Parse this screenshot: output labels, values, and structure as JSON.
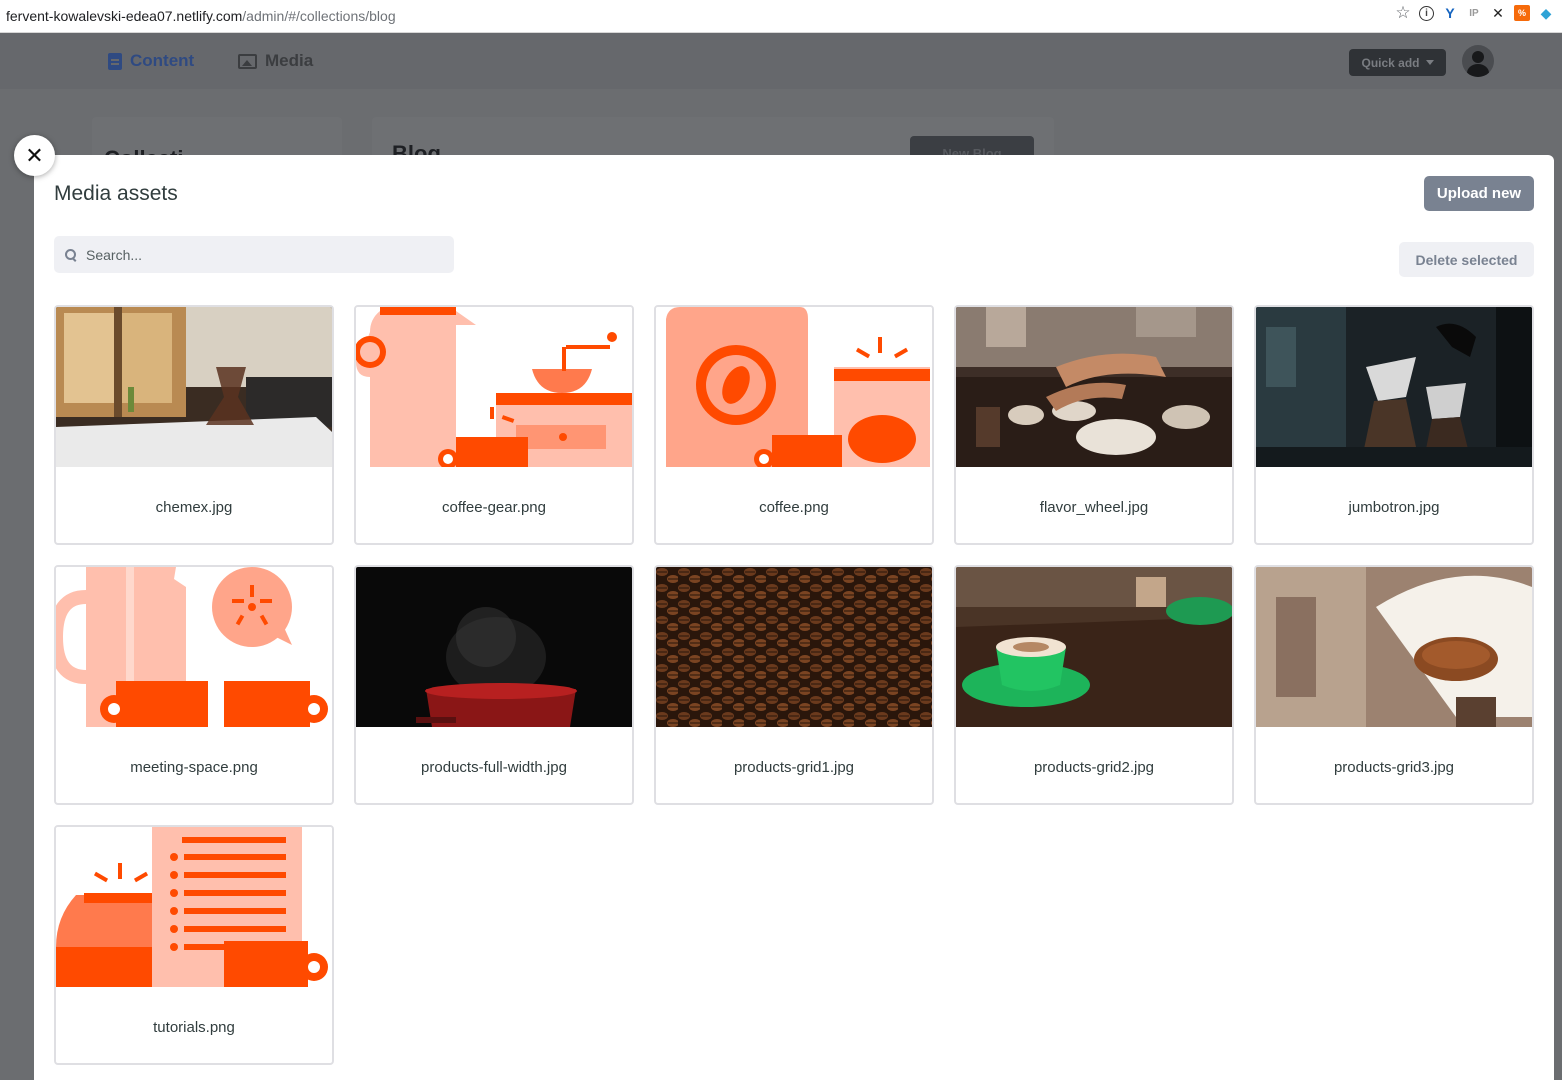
{
  "browser": {
    "url_host": "fervent-kowalevski-edea07.netlify.com",
    "url_path": "/admin/#/collections/blog",
    "extension_icons": [
      "star-icon",
      "info-icon",
      "y-extension-icon",
      "ip-extension-icon",
      "pin-extension-icon",
      "orange-extension-icon",
      "diamond-extension-icon"
    ]
  },
  "header": {
    "nav": [
      {
        "label": "Content",
        "icon": "document-icon"
      },
      {
        "label": "Media",
        "icon": "image-icon"
      }
    ],
    "quick_add_label": "Quick add"
  },
  "background": {
    "collections_title": "Collecti",
    "blog_title": "Blog",
    "new_blog_label": "New Blog"
  },
  "modal": {
    "title": "Media assets",
    "upload_label": "Upload new",
    "search_placeholder": "Search...",
    "delete_label": "Delete selected",
    "close_icon": "close-icon",
    "assets": [
      {
        "name": "chemex.jpg",
        "kind": "photo"
      },
      {
        "name": "coffee-gear.png",
        "kind": "illustration"
      },
      {
        "name": "coffee.png",
        "kind": "illustration"
      },
      {
        "name": "flavor_wheel.jpg",
        "kind": "photo"
      },
      {
        "name": "jumbotron.jpg",
        "kind": "photo"
      },
      {
        "name": "meeting-space.png",
        "kind": "illustration"
      },
      {
        "name": "products-full-width.jpg",
        "kind": "photo"
      },
      {
        "name": "products-grid1.jpg",
        "kind": "photo"
      },
      {
        "name": "products-grid2.jpg",
        "kind": "photo"
      },
      {
        "name": "products-grid3.jpg",
        "kind": "photo"
      },
      {
        "name": "tutorials.png",
        "kind": "illustration"
      }
    ]
  },
  "colors": {
    "accent_orange": "#ff4a00",
    "light_orange": "#ffbfad",
    "button_gray": "#798291"
  }
}
